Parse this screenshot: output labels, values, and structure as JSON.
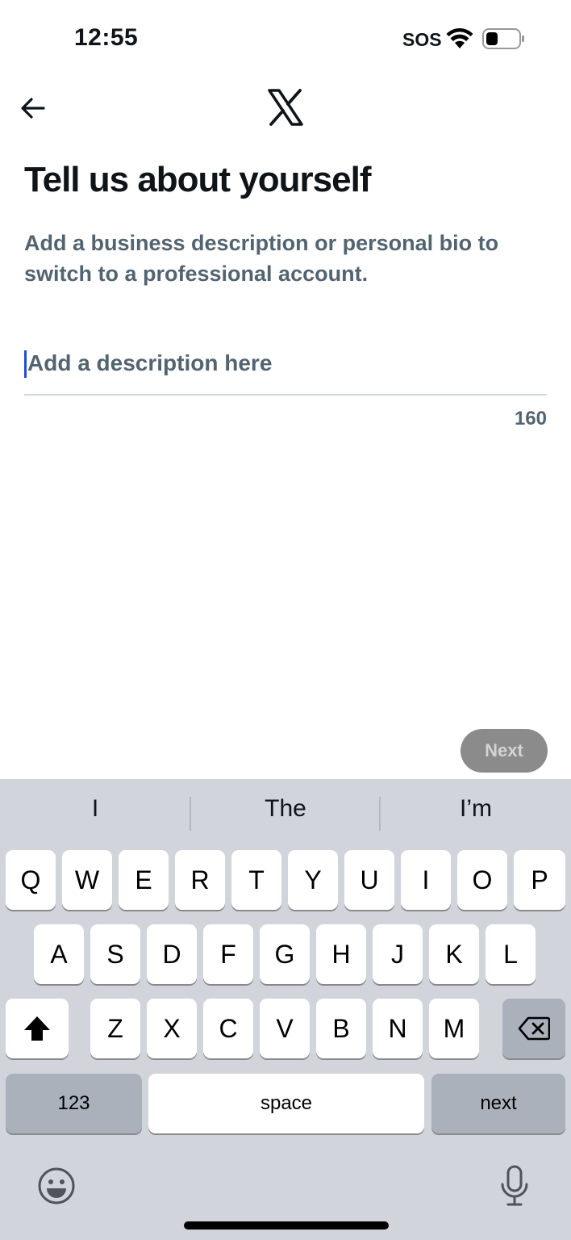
{
  "status_bar": {
    "time": "12:55",
    "carrier": "SOS",
    "icons": [
      "wifi-icon",
      "battery-icon"
    ]
  },
  "header": {
    "back_icon": "arrow-left-icon",
    "logo_icon": "x-logo-icon"
  },
  "content": {
    "title": "Tell us about yourself",
    "subtitle": "Add a business description or personal bio to switch to a professional account.",
    "description_placeholder": "Add a description here",
    "description_value": "",
    "char_count": "160",
    "next_label": "Next"
  },
  "keyboard": {
    "suggestions": [
      "I",
      "The",
      "I’m"
    ],
    "row1": [
      "Q",
      "W",
      "E",
      "R",
      "T",
      "Y",
      "U",
      "I",
      "O",
      "P"
    ],
    "row2": [
      "A",
      "S",
      "D",
      "F",
      "G",
      "H",
      "J",
      "K",
      "L"
    ],
    "row3": [
      "Z",
      "X",
      "C",
      "V",
      "B",
      "N",
      "M"
    ],
    "numbers_label": "123",
    "space_label": "space",
    "return_label": "next",
    "icons": [
      "shift-icon",
      "backspace-icon",
      "emoji-icon",
      "microphone-icon"
    ]
  },
  "colors": {
    "text_primary": "#0f1419",
    "text_secondary": "#536471",
    "button_disabled": "#8b8b8b",
    "keyboard_bg": "#d1d4db",
    "caret": "#1d4ed8"
  }
}
